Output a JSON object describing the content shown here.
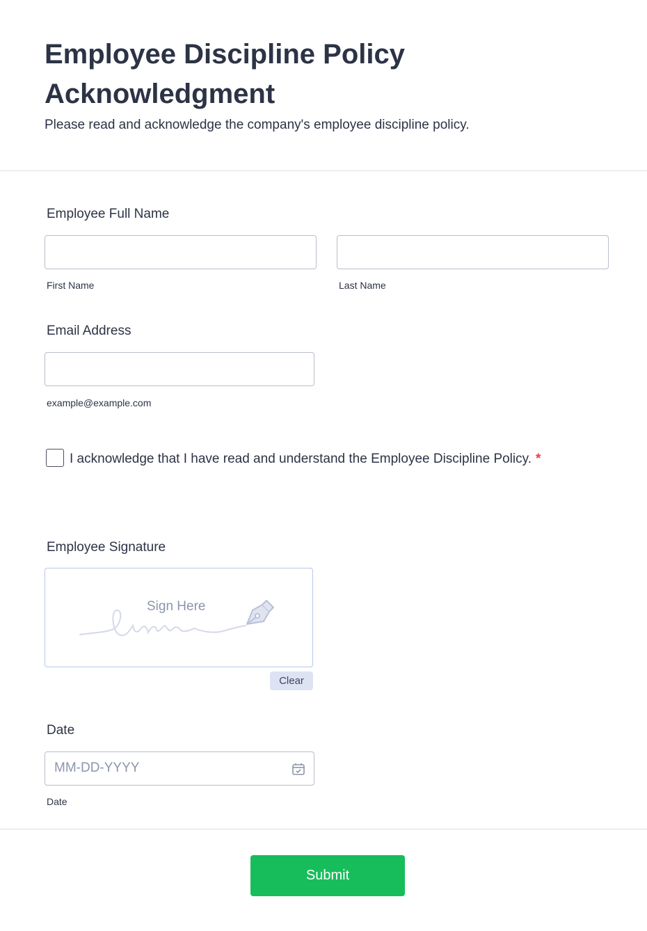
{
  "form": {
    "title": "Employee Discipline Policy Acknowledgment",
    "subtitle": "Please read and acknowledge the company's employee discipline policy."
  },
  "full_name": {
    "label": "Employee Full Name",
    "first_sublabel": "First Name",
    "last_sublabel": "Last Name",
    "first_value": "",
    "last_value": ""
  },
  "email": {
    "label": "Email Address",
    "sublabel": "example@example.com",
    "value": ""
  },
  "acknowledge": {
    "text": "I acknowledge that I have read and understand the Employee Discipline Policy.",
    "required_mark": "*",
    "checked": false
  },
  "signature": {
    "label": "Employee Signature",
    "placeholder": "Sign Here",
    "clear_label": "Clear",
    "icon": "pen-nib-icon"
  },
  "date": {
    "label": "Date",
    "placeholder": "MM-DD-YYYY",
    "sublabel": "Date",
    "icon": "calendar-icon"
  },
  "submit": {
    "label": "Submit"
  },
  "colors": {
    "text": "#2c3345",
    "submit_bg": "#18bd5b",
    "required": "#f23a3c",
    "clear_bg": "#dde3f3"
  }
}
